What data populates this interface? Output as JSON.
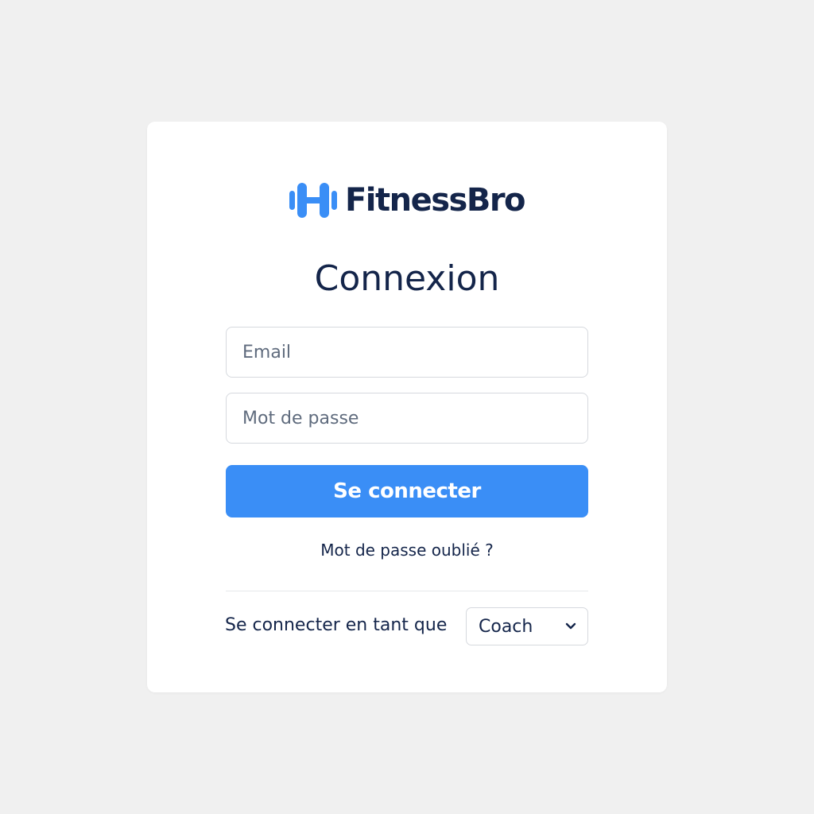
{
  "brand": {
    "name": "FitnessBro",
    "logo_icon": "dumbbell-h-logo",
    "accent_color": "#3a8ef6",
    "text_color": "#14254a"
  },
  "login": {
    "title": "Connexion",
    "email_placeholder": "Email",
    "password_placeholder": "Mot de passe",
    "submit_label": "Se connecter",
    "forgot_label": "Mot de passe oublié ?"
  },
  "role": {
    "label": "Se connecter en tant que",
    "selected": "Coach",
    "dropdown_icon": "chevron-down-icon"
  }
}
